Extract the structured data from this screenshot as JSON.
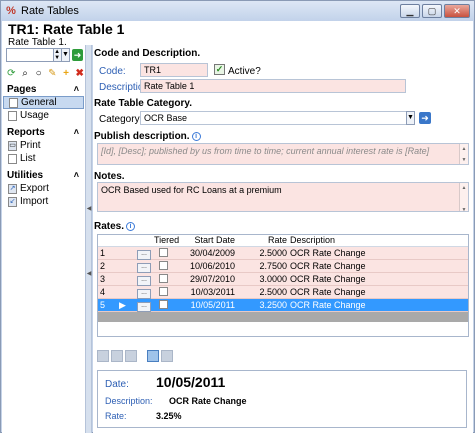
{
  "window": {
    "title": "Rate Tables",
    "app_icon_glyph": "%"
  },
  "header": {
    "title": "TR1: Rate Table 1",
    "subtitle": "Rate Table 1."
  },
  "sidebar": {
    "sections": [
      {
        "label": "Pages",
        "items": [
          {
            "label": "General",
            "icon": "page-icon",
            "selected": true
          },
          {
            "label": "Usage",
            "icon": "page-icon",
            "selected": false
          }
        ]
      },
      {
        "label": "Reports",
        "items": [
          {
            "label": "Print",
            "icon": "print-icon",
            "selected": false
          },
          {
            "label": "List",
            "icon": "list-icon",
            "selected": false
          }
        ]
      },
      {
        "label": "Utilities",
        "items": [
          {
            "label": "Export",
            "icon": "export-icon",
            "selected": false
          },
          {
            "label": "Import",
            "icon": "import-icon",
            "selected": false
          }
        ]
      }
    ]
  },
  "form": {
    "code_section": "Code and Description.",
    "code_label": "Code:",
    "code_value": "TR1",
    "active_label": "Active?",
    "active_checked": true,
    "description_label": "Description:",
    "description_value": "Rate Table 1",
    "category_section": "Rate Table Category.",
    "category_label": "Category:",
    "category_value": "OCR Base",
    "publish_section": "Publish description.",
    "publish_value": "[Id], [Desc]; published by us from time to time; current annual interest rate is [Rate]",
    "notes_section": "Notes.",
    "notes_value": "OCR Based used for RC Loans at a premium",
    "rates_section": "Rates."
  },
  "rates": {
    "columns": [
      "Tiered",
      "Start Date",
      "Rate",
      "Description"
    ],
    "ellipsis": "...",
    "current_marker": "▶",
    "rows": [
      {
        "num": "1",
        "start": "30/04/2009",
        "rate": "2.5000",
        "desc": "OCR Rate Change",
        "selected": false
      },
      {
        "num": "2",
        "start": "10/06/2010",
        "rate": "2.7500",
        "desc": "OCR Rate Change",
        "selected": false
      },
      {
        "num": "3",
        "start": "29/07/2010",
        "rate": "3.0000",
        "desc": "OCR Rate Change",
        "selected": false
      },
      {
        "num": "4",
        "start": "10/03/2011",
        "rate": "2.5000",
        "desc": "OCR Rate Change",
        "selected": false
      },
      {
        "num": "5",
        "start": "10/05/2011",
        "rate": "3.2500",
        "desc": "OCR Rate Change",
        "selected": true
      }
    ]
  },
  "detail": {
    "date_label": "Date:",
    "date_value": "10/05/2011",
    "description_label": "Description:",
    "description_value": "OCR Rate Change",
    "rate_label": "Rate:",
    "rate_value": "3.25%"
  },
  "colors": {
    "required_field_bg": "#fbe4e2",
    "selection_blue": "#3399ff",
    "label_blue": "#2d5fb4"
  }
}
